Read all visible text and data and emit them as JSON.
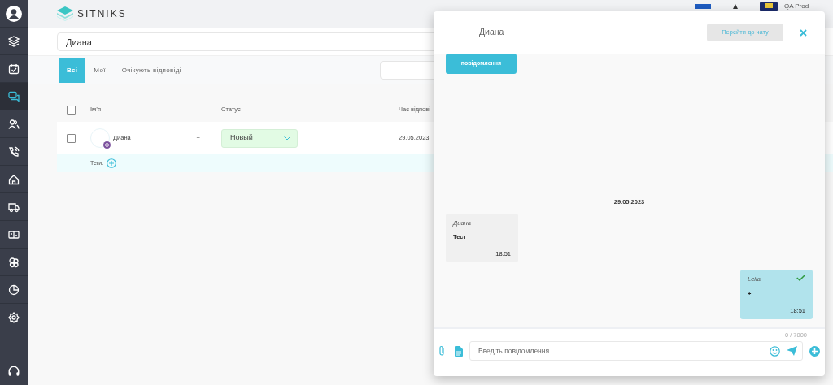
{
  "logo": {
    "text": "SITNIKS"
  },
  "header": {
    "account": "QA Prod"
  },
  "sidebar": {
    "items": [
      {
        "selected": false
      },
      {
        "selected": false
      },
      {
        "selected": true
      },
      {
        "selected": false
      },
      {
        "selected": false
      },
      {
        "selected": false
      },
      {
        "selected": false
      },
      {
        "selected": false
      },
      {
        "selected": false
      },
      {
        "selected": false
      },
      {
        "selected": false
      }
    ]
  },
  "search": {
    "value": "Диана"
  },
  "tabs": [
    {
      "label": "Всі",
      "selected": true
    },
    {
      "label": "Мої",
      "selected": false
    },
    {
      "label": "Очікують відповіді",
      "selected": false
    }
  ],
  "date_filter": {
    "value": "–"
  },
  "table": {
    "select_all_checked": false,
    "columns": [
      "Ім’я",
      "Статус",
      "Час відпові"
    ],
    "rows": [
      {
        "checked": false,
        "name": "Диана",
        "action": "+",
        "status": "Новый",
        "time": "29.05.2023,",
        "tags_label": "Теги:"
      }
    ]
  },
  "chat": {
    "title": "Диана",
    "open_button": "Перейти до чату",
    "top_button": "повідомлення",
    "date": "29.05.2023",
    "messages": [
      {
        "kind": "incoming",
        "author": "Диана",
        "text": "Тест",
        "time": "18:51",
        "read": false
      },
      {
        "kind": "outgoing",
        "author": "Leila",
        "text": "+",
        "time": "18:51",
        "read": true
      }
    ],
    "counter": "0 / 7000",
    "input": {
      "placeholder": "Введіть повідомлення"
    }
  }
}
